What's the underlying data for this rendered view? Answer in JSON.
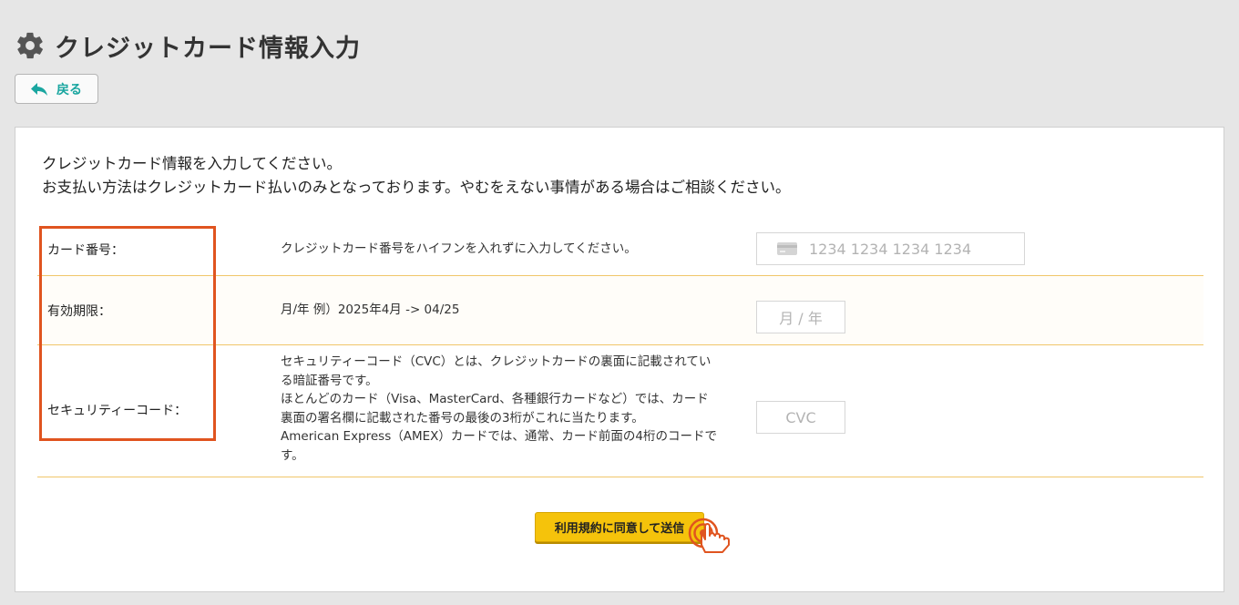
{
  "page": {
    "title": "クレジットカード情報入力",
    "back_label": "戻る"
  },
  "intro": {
    "line1": "クレジットカード情報を入力してください。",
    "line2": "お支払い方法はクレジットカード払いのみとなっております。やむをえない事情がある場合はご相談ください。"
  },
  "form": {
    "rows": [
      {
        "label": "カード番号：",
        "description": [
          "クレジットカード番号をハイフンを入れずに入力してください。"
        ],
        "placeholder": "1234 1234 1234 1234"
      },
      {
        "label": "有効期限：",
        "description": [
          "月/年 例）2025年4月 -> 04/25"
        ],
        "placeholder": "月 / 年"
      },
      {
        "label": "セキュリティーコード：",
        "description": [
          "セキュリティーコード（CVC）とは、クレジットカードの裏面に記載されてい",
          "る暗証番号です。",
          "ほとんどのカード（Visa、MasterCard、各種銀行カードなど）では、カード",
          "裏面の署名欄に記載された番号の最後の3桁がこれに当たります。",
          "American Express（AMEX）カードでは、通常、カード前面の4桁のコードで",
          "す。"
        ],
        "placeholder": "CVC"
      }
    ]
  },
  "submit": {
    "label": "利用規約に同意して送信"
  },
  "colors": {
    "accent": "#1aa6a0",
    "highlight": "#e0541f",
    "button": "#f5c30b",
    "row_divider": "#f0c66a"
  },
  "icons": {
    "title": "gear-icon",
    "back": "back-arrow-icon",
    "card": "credit-card-icon",
    "submit": "tap-hand-icon"
  }
}
